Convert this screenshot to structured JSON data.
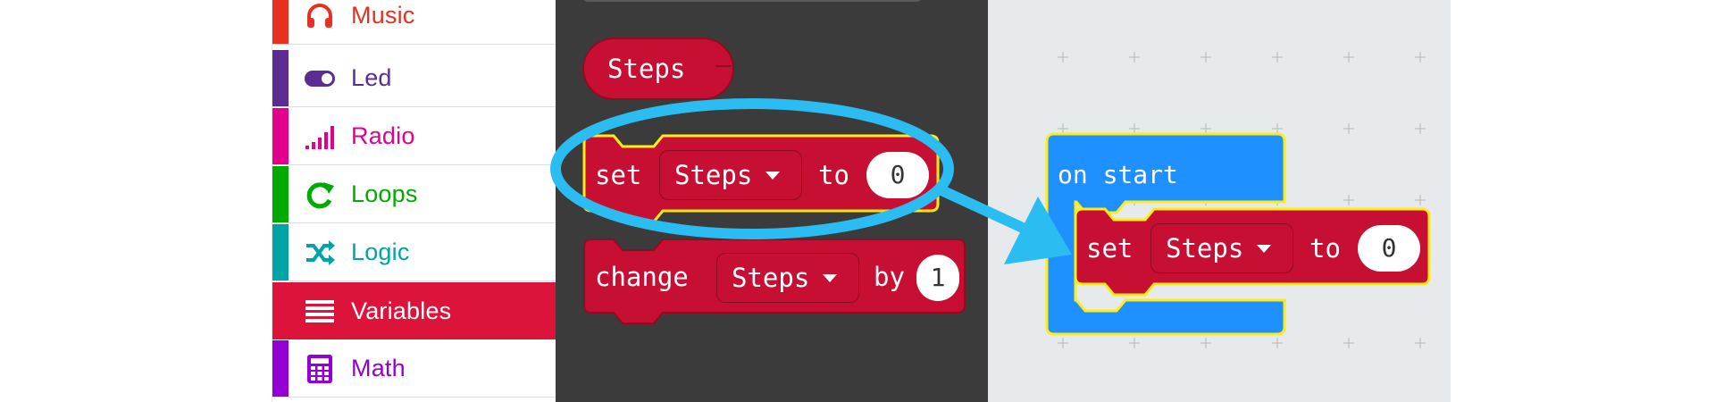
{
  "toolbox": {
    "categories": [
      {
        "label": "Music",
        "color": "#e63022",
        "icon": "headphones-icon"
      },
      {
        "label": "Led",
        "color": "#5c2d91",
        "icon": "toggle-icon"
      },
      {
        "label": "Radio",
        "color": "#e3008c",
        "icon": "signal-bars-icon"
      },
      {
        "label": "Loops",
        "color": "#00aa00",
        "icon": "loop-arrow-icon"
      },
      {
        "label": "Logic",
        "color": "#00a4a6",
        "icon": "shuffle-icon"
      },
      {
        "label": "Variables",
        "color": "#dc143c",
        "icon": "list-lines-icon",
        "selected": true
      },
      {
        "label": "Math",
        "color": "#9400d3",
        "icon": "calculator-icon"
      }
    ]
  },
  "flyout": {
    "variable_block": {
      "name": "Steps"
    },
    "set_block": {
      "keyword": "set",
      "variable": "Steps",
      "to": "to",
      "value": "0"
    },
    "change_block": {
      "keyword": "change",
      "variable": "Steps",
      "by": "by",
      "value": "1"
    }
  },
  "workspace": {
    "on_start": {
      "label": "on start",
      "color": "#1e90ff"
    },
    "set_block": {
      "keyword": "set",
      "variable": "Steps",
      "to": "to",
      "value": "0"
    }
  },
  "colors": {
    "block_red": "#c70e33",
    "highlight_yellow": "#ffec14",
    "annotation_blue": "#2bbcf2",
    "flyout_bg": "#3b3b3b",
    "workspace_bg": "#e6eaed"
  }
}
